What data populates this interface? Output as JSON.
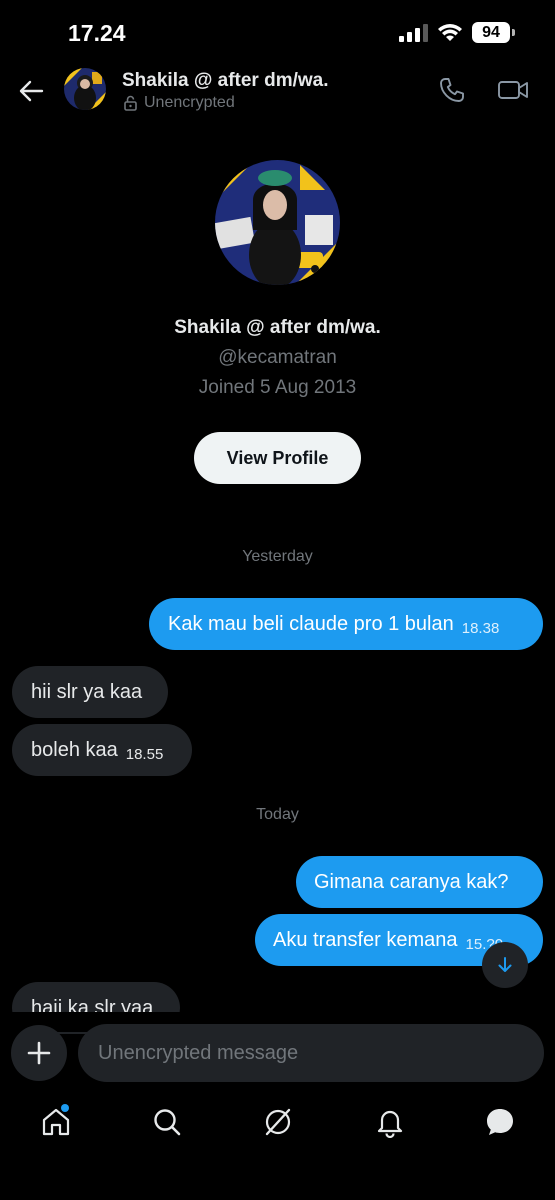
{
  "status_bar": {
    "time": "17.24",
    "battery": "94"
  },
  "header": {
    "name": "Shakila @ after dm/wa.",
    "encryption": "Unencrypted",
    "icons": [
      "back-arrow-icon",
      "avatar",
      "lock-icon",
      "phone-icon",
      "video-icon"
    ]
  },
  "profile": {
    "name": "Shakila @ after dm/wa.",
    "handle": "@kecamatran",
    "joined": "Joined 5 Aug 2013",
    "view_profile_label": "View Profile"
  },
  "conversation": {
    "yesterday_label": "Yesterday",
    "today_label": "Today",
    "yesterday": [
      {
        "dir": "out",
        "text": "Kak mau beli claude pro 1 bulan",
        "time": "18.38"
      },
      {
        "dir": "in",
        "text": "hii slr ya kaa",
        "time": ""
      },
      {
        "dir": "in",
        "text": "boleh kaa",
        "time": "18.55"
      }
    ],
    "today": [
      {
        "dir": "out",
        "text": "Gimana caranya kak?",
        "time": ""
      },
      {
        "dir": "out",
        "text": "Aku transfer kemana",
        "time": "15.?0"
      },
      {
        "dir": "in",
        "text": "haii ka slr yaa",
        "time": ""
      }
    ]
  },
  "composer": {
    "placeholder": "Unencrypted message"
  },
  "tabbar": {
    "items": [
      "home-icon",
      "search-icon",
      "grok-icon",
      "notifications-icon",
      "messages-icon"
    ]
  },
  "colors": {
    "background": "#000000",
    "outgoing_bubble": "#1d9bf0",
    "incoming_bubble": "#202327",
    "secondary_text": "#71767b",
    "button_bg": "#eff3f4"
  }
}
